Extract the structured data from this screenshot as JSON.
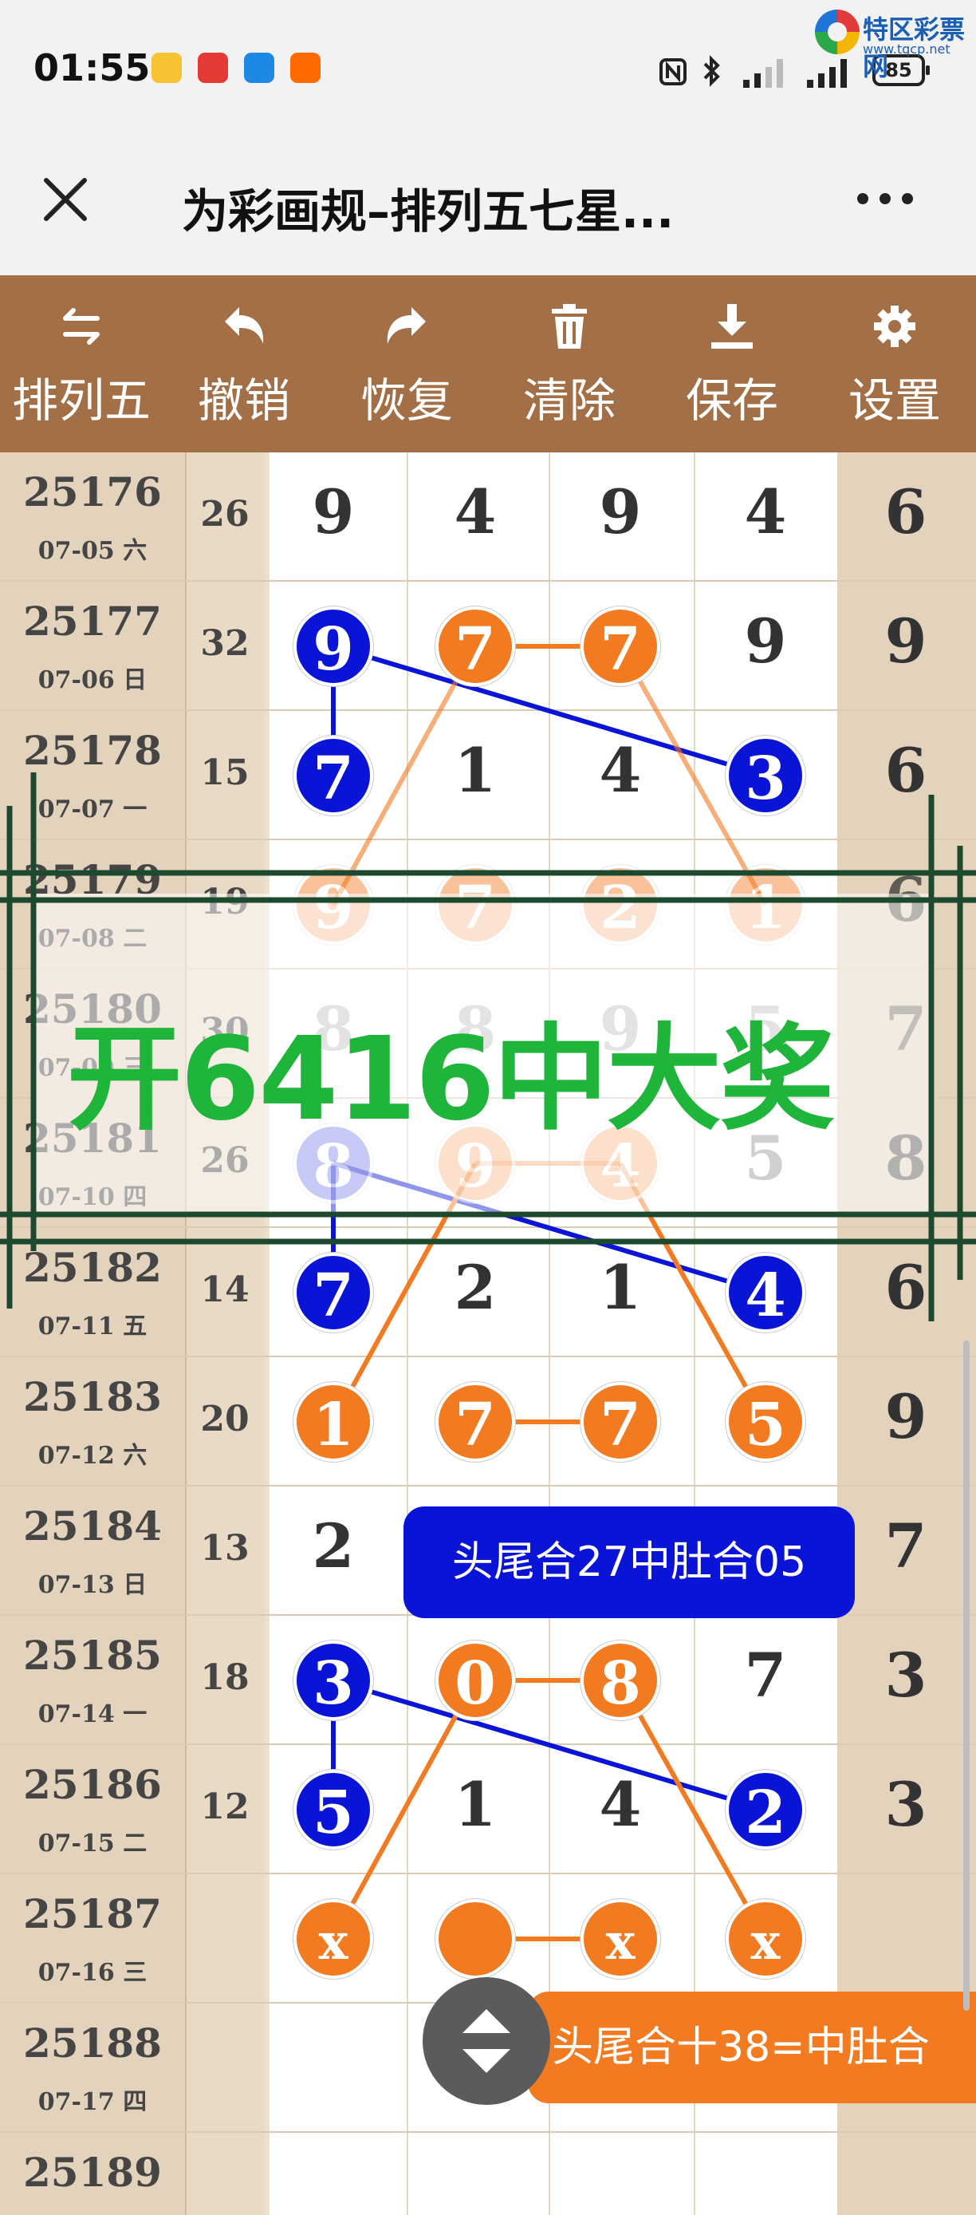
{
  "status_bar": {
    "time": "01:55",
    "battery": "85",
    "watermark_title": "特区彩票网",
    "watermark_url": "www.tqcp.net"
  },
  "titlebar": {
    "title": "为彩画规–排列五七星..."
  },
  "toolbar": {
    "items": [
      {
        "label": "排列五",
        "icon": "swap-icon"
      },
      {
        "label": "撤销",
        "icon": "undo-icon"
      },
      {
        "label": "恢复",
        "icon": "redo-icon"
      },
      {
        "label": "清除",
        "icon": "trash-icon"
      },
      {
        "label": "保存",
        "icon": "download-icon"
      },
      {
        "label": "设置",
        "icon": "gear-icon"
      }
    ]
  },
  "rows": [
    {
      "period": "25176",
      "date": "07-05 六",
      "sum": "26",
      "digits": [
        "9",
        "4",
        "9",
        "4"
      ],
      "fifth": "6"
    },
    {
      "period": "25177",
      "date": "07-06 日",
      "sum": "32",
      "digits": [
        "9",
        "7",
        "7",
        "9"
      ],
      "fifth": "9"
    },
    {
      "period": "25178",
      "date": "07-07 一",
      "sum": "15",
      "digits": [
        "7",
        "1",
        "4",
        "3"
      ],
      "fifth": "6"
    },
    {
      "period": "25179",
      "date": "07-08 二",
      "sum": "19",
      "digits": [
        "9",
        "7",
        "2",
        "1"
      ],
      "fifth": "6"
    },
    {
      "period": "25180",
      "date": "07-09 三",
      "sum": "30",
      "digits": [
        "8",
        "8",
        "9",
        "5"
      ],
      "fifth": "7"
    },
    {
      "period": "25181",
      "date": "07-10 四",
      "sum": "26",
      "digits": [
        "8",
        "9",
        "4",
        "5"
      ],
      "fifth": "8"
    },
    {
      "period": "25182",
      "date": "07-11 五",
      "sum": "14",
      "digits": [
        "7",
        "2",
        "1",
        "4"
      ],
      "fifth": "6"
    },
    {
      "period": "25183",
      "date": "07-12 六",
      "sum": "20",
      "digits": [
        "1",
        "7",
        "7",
        "5"
      ],
      "fifth": "9"
    },
    {
      "period": "25184",
      "date": "07-13 日",
      "sum": "13",
      "digits": [
        "2",
        "",
        "",
        ""
      ],
      "fifth": "7"
    },
    {
      "period": "25185",
      "date": "07-14 一",
      "sum": "18",
      "digits": [
        "3",
        "0",
        "8",
        "7"
      ],
      "fifth": "3"
    },
    {
      "period": "25186",
      "date": "07-15 二",
      "sum": "12",
      "digits": [
        "5",
        "1",
        "4",
        "2"
      ],
      "fifth": "3"
    },
    {
      "period": "25187",
      "date": "07-16 三",
      "sum": "",
      "digits": [
        "x",
        "",
        "x",
        "x"
      ],
      "fifth": ""
    },
    {
      "period": "25188",
      "date": "07-17 四",
      "sum": "",
      "digits": [
        "",
        "",
        "",
        ""
      ],
      "fifth": ""
    },
    {
      "period": "25189",
      "date": "",
      "sum": "",
      "digits": [
        "",
        "",
        "",
        ""
      ],
      "fifth": ""
    }
  ],
  "overlay": {
    "text": "开6416中大奖"
  },
  "tooltips": {
    "tip1": "头尾合27中肚合05",
    "tip2": "头尾合十38=中肚合"
  },
  "colors": {
    "toolbar": "#a36f46",
    "ball_blue": "#0a14d6",
    "ball_orange": "#f27a21",
    "overlay_text": "#1fb43a",
    "frame": "#1d4a2e"
  }
}
